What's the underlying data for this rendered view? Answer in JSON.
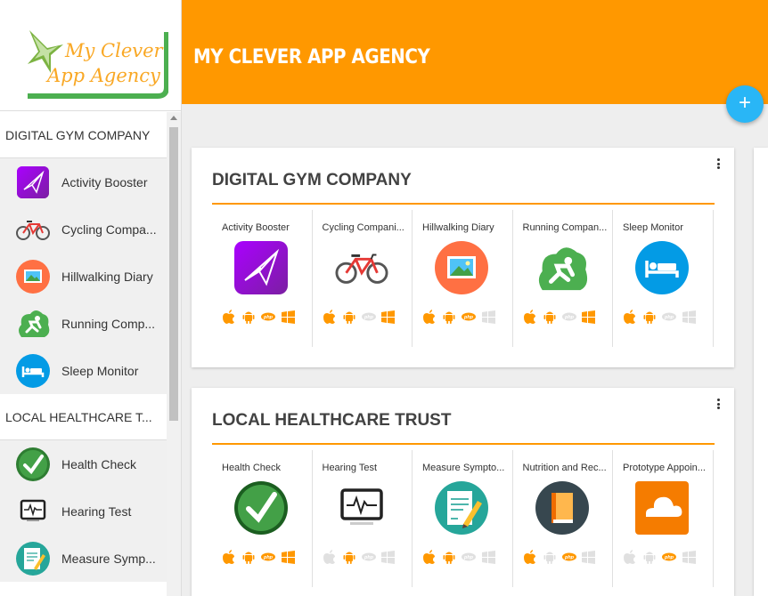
{
  "header": {
    "title": "MY CLEVER APP AGENCY",
    "logo_line1": "My Clever",
    "logo_line2": "App Agency",
    "add_button": "+"
  },
  "sidebar": {
    "groups": [
      {
        "label": "DIGITAL GYM COMPANY",
        "items": [
          {
            "label": "Activity Booster",
            "icon": "paper-plane-icon"
          },
          {
            "label": "Cycling Compa...",
            "icon": "bicycle-icon"
          },
          {
            "label": "Hillwalking Diary",
            "icon": "landscape-icon"
          },
          {
            "label": "Running Comp...",
            "icon": "runner-icon"
          },
          {
            "label": "Sleep Monitor",
            "icon": "bed-icon"
          }
        ]
      },
      {
        "label": "LOCAL HEALTHCARE T...",
        "items": [
          {
            "label": "Health Check",
            "icon": "checkmark-icon"
          },
          {
            "label": "Hearing Test",
            "icon": "monitor-pulse-icon"
          },
          {
            "label": "Measure Symp...",
            "icon": "notepad-icon"
          }
        ]
      }
    ]
  },
  "cards": [
    {
      "title": "DIGITAL GYM COMPANY",
      "apps": [
        {
          "name": "Activity Booster",
          "icon": "paper-plane-icon",
          "platforms": {
            "ios": true,
            "android": true,
            "php": true,
            "windows": true
          }
        },
        {
          "name": "Cycling Compani...",
          "icon": "bicycle-icon",
          "platforms": {
            "ios": true,
            "android": true,
            "php": false,
            "windows": true
          }
        },
        {
          "name": "Hillwalking Diary",
          "icon": "landscape-icon",
          "platforms": {
            "ios": true,
            "android": true,
            "php": true,
            "windows": false
          }
        },
        {
          "name": "Running Compan...",
          "icon": "runner-icon",
          "platforms": {
            "ios": true,
            "android": true,
            "php": false,
            "windows": true
          }
        },
        {
          "name": "Sleep Monitor",
          "icon": "bed-icon",
          "platforms": {
            "ios": true,
            "android": true,
            "php": false,
            "windows": false
          }
        }
      ]
    },
    {
      "title": "LOCAL HEALTHCARE TRUST",
      "apps": [
        {
          "name": "Health Check",
          "icon": "checkmark-icon",
          "platforms": {
            "ios": true,
            "android": true,
            "php": true,
            "windows": true
          }
        },
        {
          "name": "Hearing Test",
          "icon": "monitor-pulse-icon",
          "platforms": {
            "ios": false,
            "android": true,
            "php": false,
            "windows": false
          }
        },
        {
          "name": "Measure Sympto...",
          "icon": "notepad-icon",
          "platforms": {
            "ios": true,
            "android": true,
            "php": false,
            "windows": false
          }
        },
        {
          "name": "Nutrition and Rec...",
          "icon": "book-icon",
          "platforms": {
            "ios": true,
            "android": false,
            "php": true,
            "windows": false
          }
        },
        {
          "name": "Prototype Appoin...",
          "icon": "cloud-icon",
          "platforms": {
            "ios": false,
            "android": false,
            "php": true,
            "windows": false
          }
        }
      ]
    }
  ],
  "platform_labels": {
    "php": "php"
  },
  "colors": {
    "accent": "#ff9800",
    "fab": "#29b6f6",
    "disabled": "#e0e0e0"
  }
}
